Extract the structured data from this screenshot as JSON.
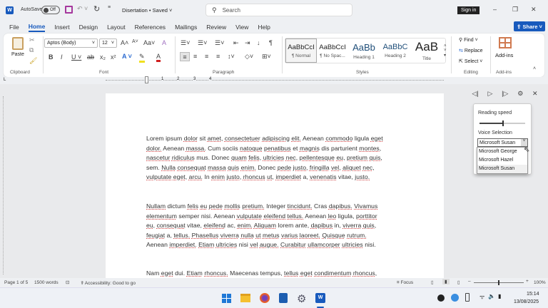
{
  "titlebar": {
    "autosave_label": "AutoSave",
    "autosave_state": "Off",
    "doc_title": "Disertation • Saved",
    "search_placeholder": "Search",
    "signin": "Sign in"
  },
  "tabs": [
    "File",
    "Home",
    "Insert",
    "Design",
    "Layout",
    "References",
    "Mailings",
    "Review",
    "View",
    "Help"
  ],
  "share": "Share",
  "ribbon": {
    "clipboard": {
      "paste": "Paste",
      "label": "Clipboard"
    },
    "font": {
      "name": "Aptos (Body)",
      "size": "12",
      "label": "Font",
      "case": "Aa"
    },
    "paragraph": {
      "label": "Paragraph"
    },
    "styles": {
      "label": "Styles",
      "items": [
        {
          "sample": "AaBbCcI",
          "name": "¶ Normal"
        },
        {
          "sample": "AaBbCcI",
          "name": "¶ No Spac..."
        },
        {
          "sample": "AaBb",
          "name": "Heading 1"
        },
        {
          "sample": "AaBbC",
          "name": "Heading 2"
        },
        {
          "sample": "AaB",
          "name": "Title"
        }
      ]
    },
    "editing": {
      "find": "Find",
      "replace": "Replace",
      "select": "Select",
      "label": "Editing"
    },
    "addins": {
      "button": "Add-ins",
      "label": "Add-ins"
    }
  },
  "ruler": [
    "1",
    "2",
    "3",
    "4"
  ],
  "document": {
    "lines": [
      "Lorem ipsum dolor sit amet, consectetuer adipiscing elit. Aenean commodo ligula eget",
      "dolor. Aenean massa. Cum sociis natoque penatibus et magnis dis parturient montes,",
      "nascetur ridiculus mus. Donec quam felis, ultricies nec, pellentesque eu, pretium quis,",
      "sem. Nulla consequat massa quis enim. Donec pede justo, fringilla vel, aliquet nec,",
      "vulputate eget, arcu. In enim justo, rhoncus ut, imperdiet a, venenatis vitae, justo.",
      "Nullam dictum felis eu pede mollis pretium. Integer tincidunt. Cras dapibus. Vivamus",
      "elementum semper nisi. Aenean vulputate eleifend tellus. Aenean leo ligula, porttitor",
      "eu, consequat vitae, eleifend ac, enim. Aliquam lorem ante, dapibus in, viverra quis,",
      "feugiat a, tellus. Phasellus viverra nulla ut metus varius laoreet. Quisque rutrum.",
      "Aenean imperdiet. Etiam ultricies nisi vel augue. Curabitur ullamcorper ultricies nisi.",
      "Nam eget dui. Etiam rhoncus. Maecenas tempus, tellus eget condimentum rhoncus,"
    ]
  },
  "read_aloud": {
    "speed_label": "Reading speed",
    "speed_value": 0.5,
    "voice_label": "Voice Selection",
    "selected_voice": "Microsoft Susan",
    "options": [
      "Microsoft George",
      "Microsoft Hazel",
      "Microsoft Susan"
    ]
  },
  "statusbar": {
    "page": "Page 1 of 5",
    "words": "1500 words",
    "accessibility": "Accessibility: Good to go",
    "focus": "Focus",
    "zoom": "100%"
  },
  "taskbar": {
    "time": "15:14",
    "date": "13/08/2025"
  },
  "colors": {
    "accent": "#185abd",
    "word": "#185abd",
    "save_icon": "#a5379d"
  }
}
